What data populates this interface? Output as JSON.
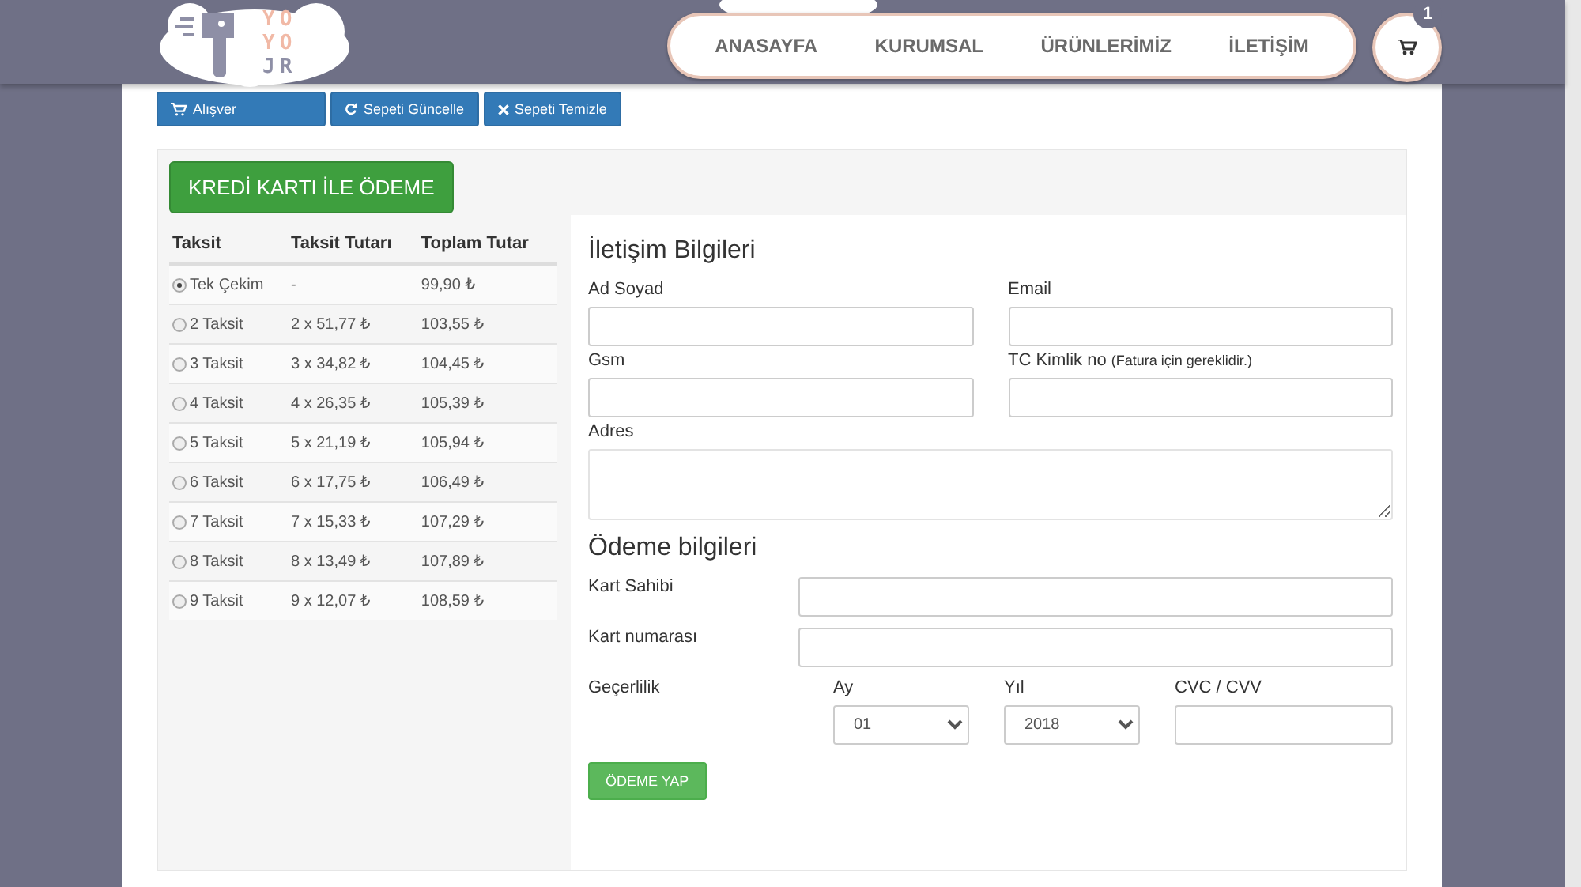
{
  "logo": {
    "lines": [
      "YO",
      "YO",
      "JR"
    ]
  },
  "nav": {
    "items": [
      {
        "label": "ANASAYFA"
      },
      {
        "label": "KURUMSAL"
      },
      {
        "label": "ÜRÜNLERİMİZ"
      },
      {
        "label": "İLETİŞİM"
      }
    ]
  },
  "cart": {
    "count": "1"
  },
  "cart_buttons": [
    {
      "label": "Alışver"
    },
    {
      "label": "Sepeti Güncelle"
    },
    {
      "label": "Sepeti Temizle"
    }
  ],
  "payment": {
    "title": "KREDİ KARTI İLE ÖDEME",
    "table": {
      "columns": [
        "Taksit",
        "Taksit Tutarı",
        "Toplam Tutar"
      ],
      "rows": [
        {
          "label": "Tek Çekim",
          "installment": "-",
          "total": "99,90 ₺",
          "selected": true
        },
        {
          "label": "2 Taksit",
          "installment": "2 x 51,77 ₺",
          "total": "103,55 ₺",
          "selected": false
        },
        {
          "label": "3 Taksit",
          "installment": "3 x 34,82 ₺",
          "total": "104,45 ₺",
          "selected": false
        },
        {
          "label": "4 Taksit",
          "installment": "4 x 26,35 ₺",
          "total": "105,39 ₺",
          "selected": false
        },
        {
          "label": "5 Taksit",
          "installment": "5 x 21,19 ₺",
          "total": "105,94 ₺",
          "selected": false
        },
        {
          "label": "6 Taksit",
          "installment": "6 x 17,75 ₺",
          "total": "106,49 ₺",
          "selected": false
        },
        {
          "label": "7 Taksit",
          "installment": "7 x 15,33 ₺",
          "total": "107,29 ₺",
          "selected": false
        },
        {
          "label": "8 Taksit",
          "installment": "8 x 13,49 ₺",
          "total": "107,89 ₺",
          "selected": false
        },
        {
          "label": "9 Taksit",
          "installment": "9 x 12,07 ₺",
          "total": "108,59 ₺",
          "selected": false
        }
      ]
    },
    "contact": {
      "title": "İletişim Bilgileri",
      "fields": [
        {
          "label": "Ad Soyad",
          "kind": "input"
        },
        {
          "label": "Email",
          "kind": "input"
        },
        {
          "label": "Gsm",
          "kind": "input"
        },
        {
          "label": "TC Kimlik no",
          "note": "(Fatura için gereklidir.)",
          "kind": "input"
        },
        {
          "label": "Adres",
          "kind": "textarea"
        }
      ]
    },
    "card": {
      "title": "Ödeme bilgileri",
      "fields": [
        {
          "label": "Kart Sahibi"
        },
        {
          "label": "Kart numarası"
        }
      ],
      "validity": {
        "label": "Geçerlilik",
        "month": {
          "label": "Ay",
          "value": "01"
        },
        "year": {
          "label": "Yıl",
          "value": "2018"
        },
        "cvc": {
          "label": "CVC / CVV"
        }
      },
      "submit": "ÖDEME YAP"
    }
  }
}
